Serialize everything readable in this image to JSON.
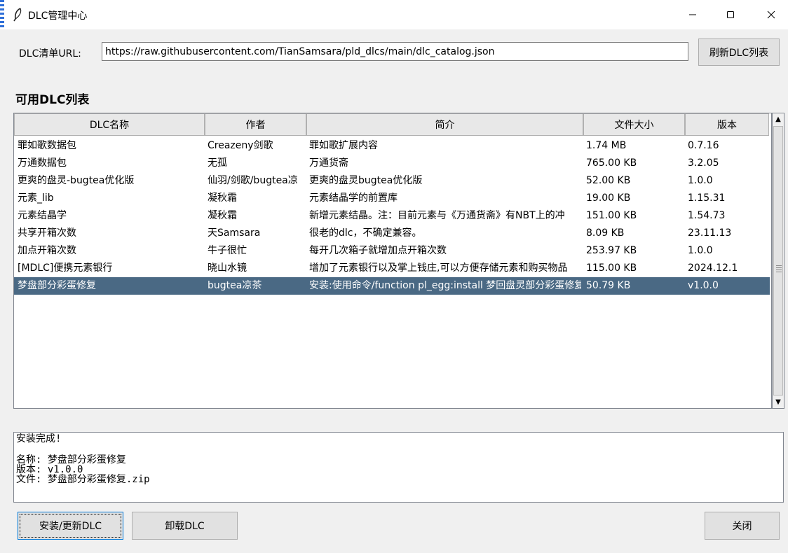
{
  "window": {
    "title": "DLC管理中心"
  },
  "url_bar": {
    "label": "DLC清单URL:",
    "value": "https://raw.githubusercontent.com/TianSamsara/pld_dlcs/main/dlc_catalog.json",
    "refresh_label": "刷新DLC列表"
  },
  "list": {
    "title": "可用DLC列表",
    "columns": [
      "DLC名称",
      "作者",
      "简介",
      "文件大小",
      "版本"
    ],
    "rows": [
      [
        "罪如歌数据包",
        "Creazeny剑歌",
        "罪如歌扩展内容",
        "1.74 MB",
        "0.7.16"
      ],
      [
        "万通数据包",
        "无孤",
        "万通货斋",
        "765.00 KB",
        "3.2.05"
      ],
      [
        "更爽的盘灵-bugtea优化版",
        "仙羽/剑歌/bugtea凉",
        "更爽的盘灵bugtea优化版",
        "52.00 KB",
        "1.0.0"
      ],
      [
        "元素_lib",
        "凝秋霜",
        "元素结晶学的前置库",
        "19.00 KB",
        "1.15.31"
      ],
      [
        "元素结晶学",
        "凝秋霜",
        "新增元素结晶。注：目前元素与《万通货斋》有NBT上的冲",
        "151.00 KB",
        "1.54.73"
      ],
      [
        "共享开箱次数",
        "天Samsara",
        "很老的dlc，不确定兼容。",
        "8.09 KB",
        "23.11.13"
      ],
      [
        "加点开箱次数",
        "牛子很忙",
        "每开几次箱子就增加点开箱次数",
        "253.97 KB",
        "1.0.0"
      ],
      [
        "[MDLC]便携元素银行",
        "晓山水镜",
        "增加了元素银行以及掌上钱庄,可以方便存储元素和购买物品",
        "115.00 KB",
        "2024.12.1"
      ],
      [
        "梦盘部分彩蛋修复",
        "bugtea凉茶",
        "安装:使用命令/function pl_egg:install 梦回盘灵部分彩蛋修复",
        "50.79 KB",
        "v1.0.0"
      ]
    ],
    "selected_index": 8
  },
  "log": {
    "lines": [
      "安装完成!",
      "",
      "名称: 梦盘部分彩蛋修复",
      "版本: v1.0.0",
      "文件: 梦盘部分彩蛋修复.zip"
    ]
  },
  "buttons": {
    "install": "安装/更新DLC",
    "uninstall": "卸载DLC",
    "close": "关闭"
  },
  "colors": {
    "selection": "#4a6984",
    "accent": "#0078d7"
  }
}
